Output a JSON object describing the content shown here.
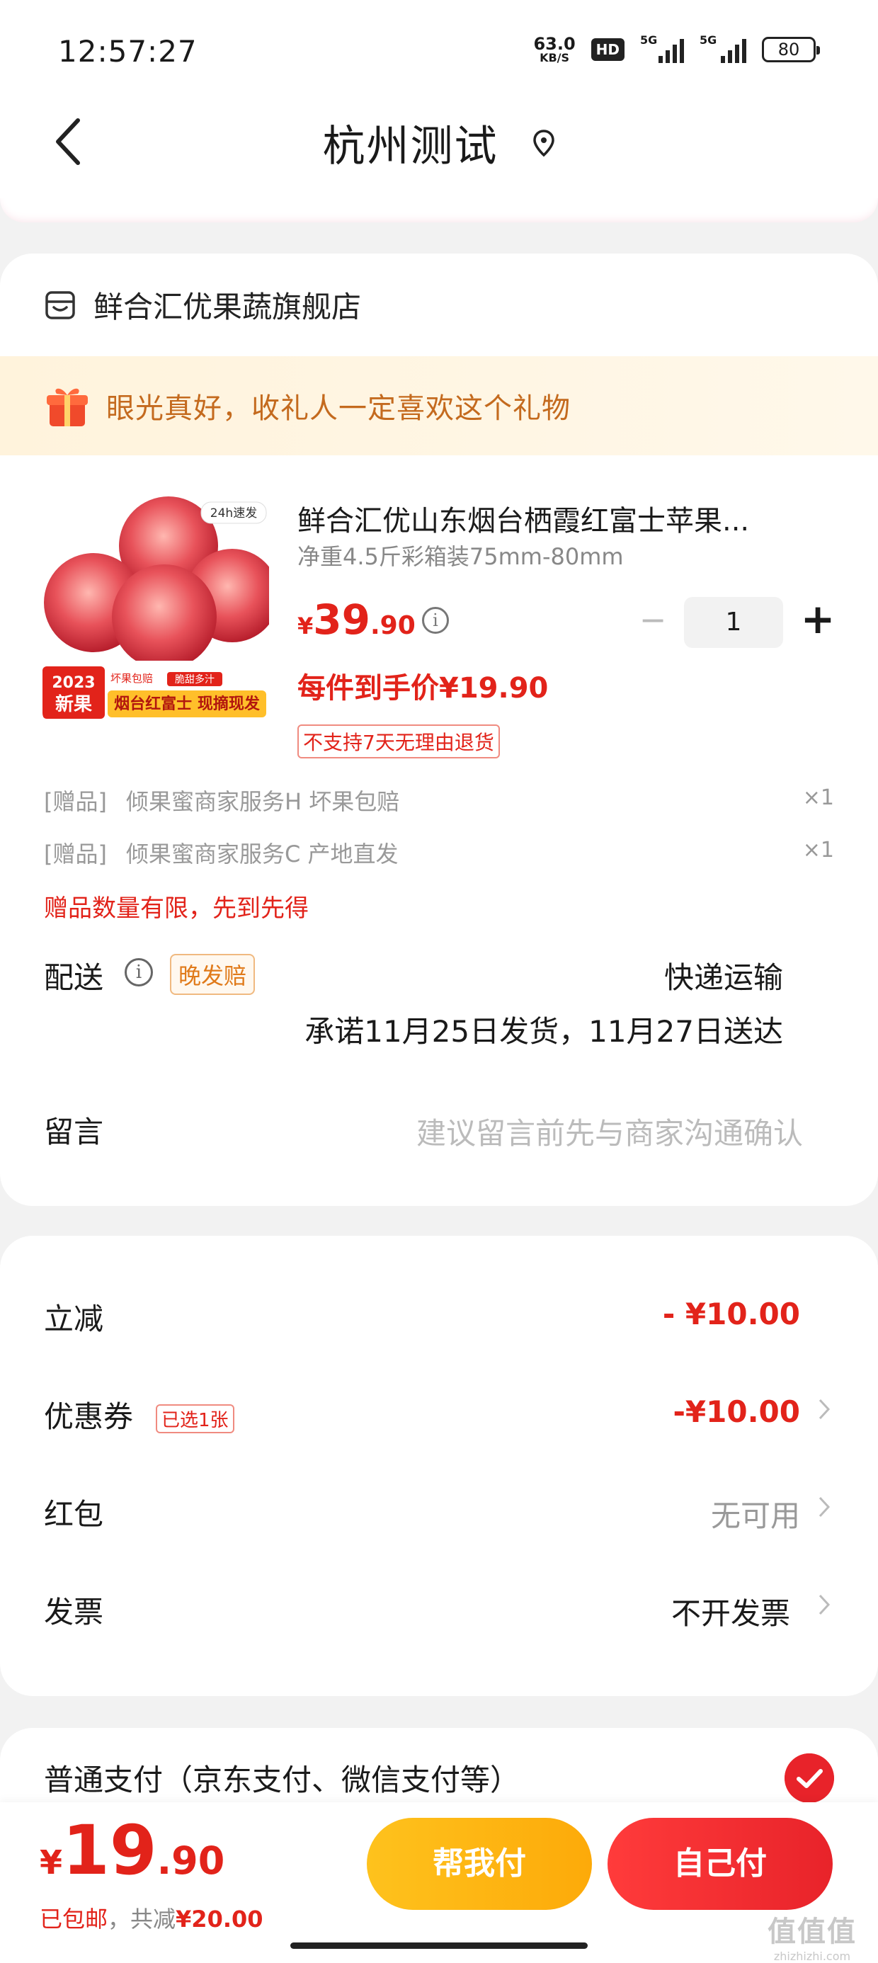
{
  "status_bar": {
    "time": "12:57:27",
    "net_speed": "63.0",
    "net_unit": "KB/S",
    "hd": "HD",
    "sig1": "5G",
    "sig2": "5G",
    "battery": "80"
  },
  "nav": {
    "title": "杭州测试",
    "back_icon": "back-arrow-icon",
    "location_icon": "location-pin-icon"
  },
  "shop": {
    "name": "鲜合汇优果蔬旗舰店",
    "gift_banner": "眼光真好，收礼人一定喜欢这个礼物"
  },
  "product": {
    "title": "鲜合汇优山东烟台栖霞红富士苹果...",
    "spec": "净重4.5斤彩箱装75mm-80mm",
    "currency": "¥",
    "price_int": "39",
    "price_dec": ".90",
    "quantity": "1",
    "minus": "−",
    "plus": "+",
    "unit_price": "每件到手价¥19.90",
    "return_tag": "不支持7天无理由退货",
    "image": {
      "badge": "24h速发",
      "year": "2023",
      "new": "新果",
      "tag1": "坏果包赔",
      "tag2": "脆甜多汁",
      "slogan": "烟台红富士 现摘现发"
    }
  },
  "gifts": [
    {
      "label": "[赠品]",
      "name": "倾果蜜商家服务H 坏果包赔",
      "count": "×1"
    },
    {
      "label": "[赠品]",
      "name": "倾果蜜商家服务C 产地直发",
      "count": "×1"
    }
  ],
  "gift_limit": "赠品数量有限，先到先得",
  "delivery": {
    "label": "配送",
    "tag": "晚发赔",
    "method": "快递运输",
    "promise": "承诺11月25日发货，11月27日送达"
  },
  "note": {
    "label": "留言",
    "placeholder": "建议留言前先与商家沟通确认"
  },
  "discounts": {
    "instant": {
      "label": "立减",
      "value": "- ¥10.00"
    },
    "coupon": {
      "label": "优惠券",
      "tag": "已选1张",
      "value": "-¥10.00"
    },
    "red_packet": {
      "label": "红包",
      "value": "无可用"
    },
    "invoice": {
      "label": "发票",
      "value": "不开发票"
    }
  },
  "payment": {
    "label": "普通支付（京东支付、微信支付等）"
  },
  "bottom": {
    "currency": "¥",
    "total_int": "19",
    "total_dec": ".90",
    "shipping": "已包邮",
    "saved_prefix": "，共减",
    "saved": "¥20.00",
    "help_pay": "帮我付",
    "self_pay": "自己付"
  },
  "watermark": {
    "text": "值值值",
    "url": "zhizhizhi.com"
  },
  "colors": {
    "accent_red": "#e2231a",
    "gold": "#fdaa09",
    "gift_orange": "#c46a1e"
  }
}
